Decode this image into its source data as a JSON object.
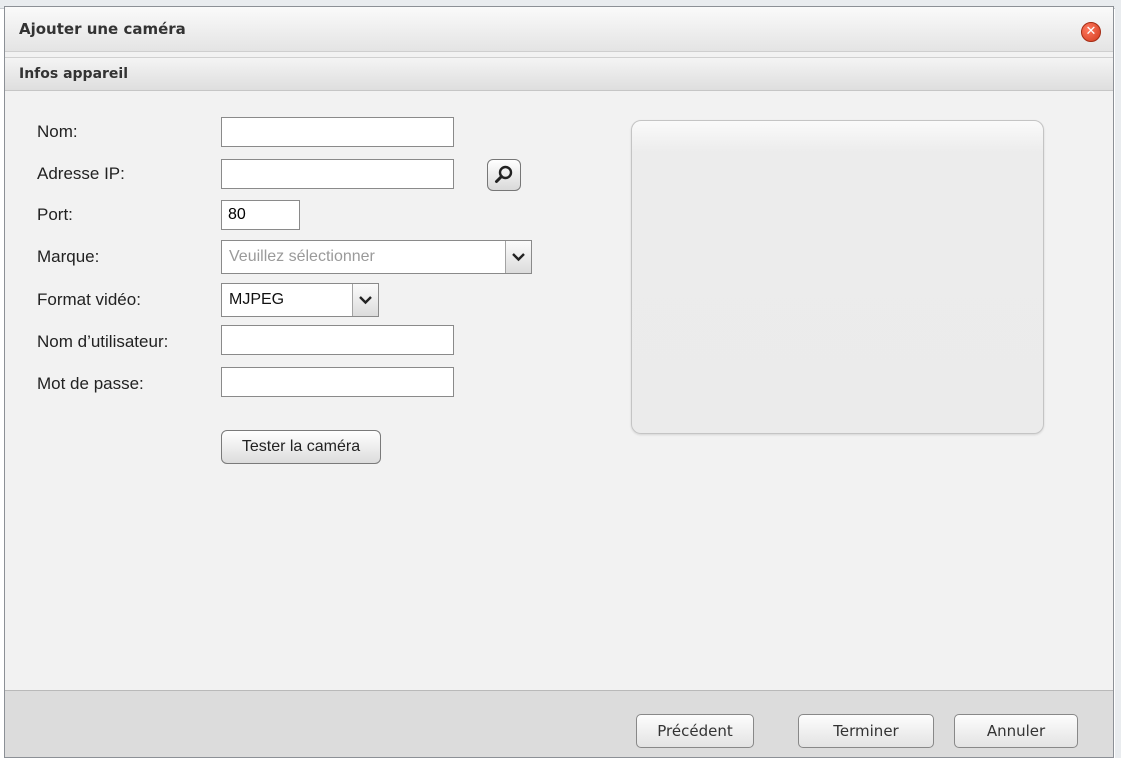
{
  "dialog": {
    "title": "Ajouter une caméra",
    "close_glyph": "✕"
  },
  "section": {
    "title": "Infos appareil"
  },
  "form": {
    "name_label": "Nom:",
    "name_value": "",
    "ip_label": "Adresse IP:",
    "ip_value": "",
    "port_label": "Port:",
    "port_value": "80",
    "brand_label": "Marque:",
    "brand_placeholder": "Veuillez sélectionner",
    "video_format_label": "Format vidéo:",
    "video_format_value": "MJPEG",
    "username_label": "Nom d’utilisateur:",
    "username_value": "",
    "password_label": "Mot de passe:",
    "password_value": "",
    "test_button": "Tester la caméra"
  },
  "footer": {
    "previous_label": "Précédent",
    "finish_label": "Terminer",
    "cancel_label": "Annuler"
  },
  "icons": {
    "close": "close-icon",
    "search": "search-icon",
    "dropdown": "chevron-down-icon"
  },
  "colors": {
    "close_button": "#d23a1c",
    "dialog_background": "#f2f2f2",
    "footer_background": "#dcdcdc"
  }
}
